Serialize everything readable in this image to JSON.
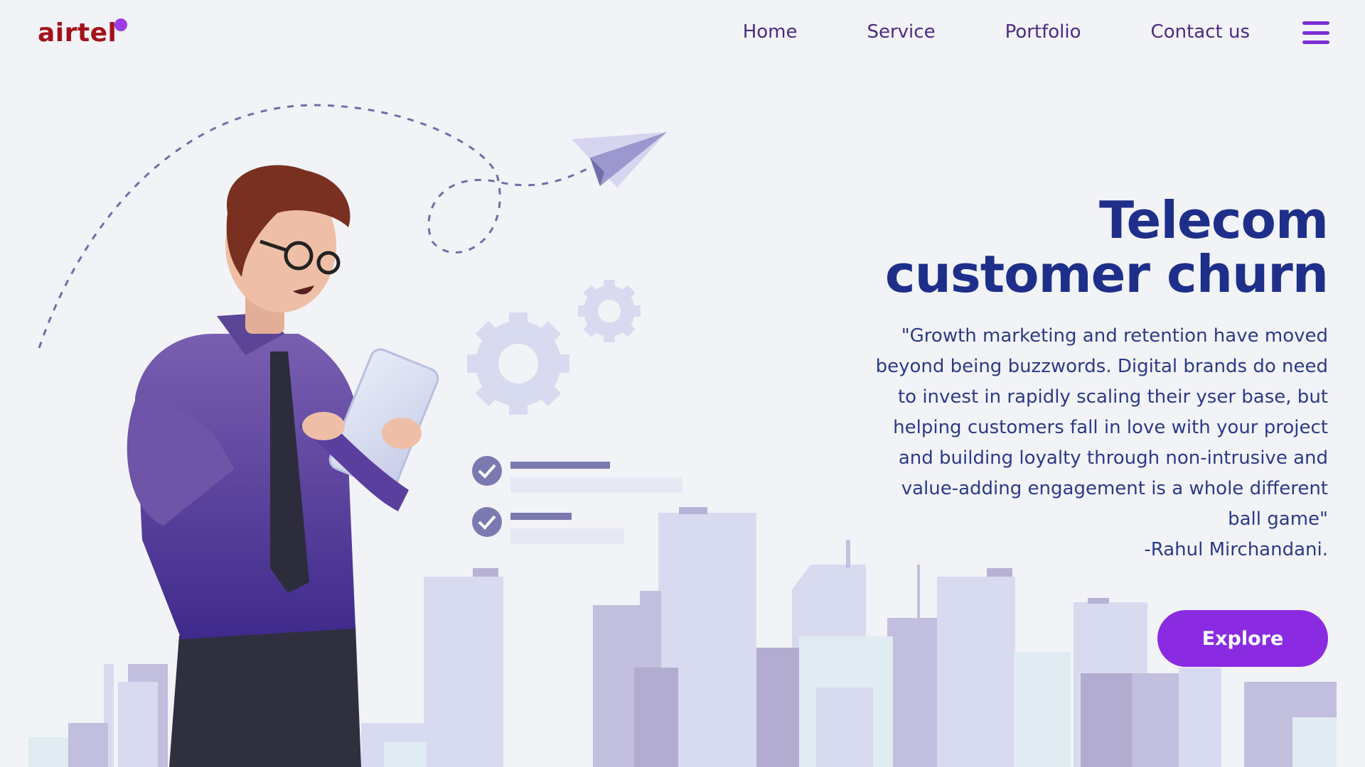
{
  "brand": {
    "name": "airtel",
    "color": "#a3121b",
    "accent_dot": "#9b3be6"
  },
  "nav": {
    "items": [
      {
        "label": "Home"
      },
      {
        "label": "Service"
      },
      {
        "label": "Portfolio"
      },
      {
        "label": "Contact us"
      }
    ],
    "menu_icon": "hamburger-menu-icon"
  },
  "hero": {
    "title_line1": "Telecom",
    "title_line2": "customer churn",
    "quote_lines": [
      "\"Growth marketing and retention have moved",
      "beyond being buzzwords. Digital brands do need",
      "to invest in rapidly scaling their yser base, but",
      "helping customers fall in love with your project",
      "and building loyalty through non-intrusive and",
      "value-adding engagement is a whole different",
      "ball game\""
    ],
    "author": "-Rahul Mirchandani.",
    "cta_label": "Explore"
  },
  "colors": {
    "background": "#f2f3f7",
    "title": "#1e2f8a",
    "body_text": "#2c3a86",
    "nav_text": "#4c2a82",
    "cta": "#8a2be2"
  },
  "illustration": {
    "icons": [
      "paper-plane-icon",
      "gear-icon",
      "checkmark-icon",
      "city-skyline",
      "businessman-with-tablet"
    ]
  }
}
